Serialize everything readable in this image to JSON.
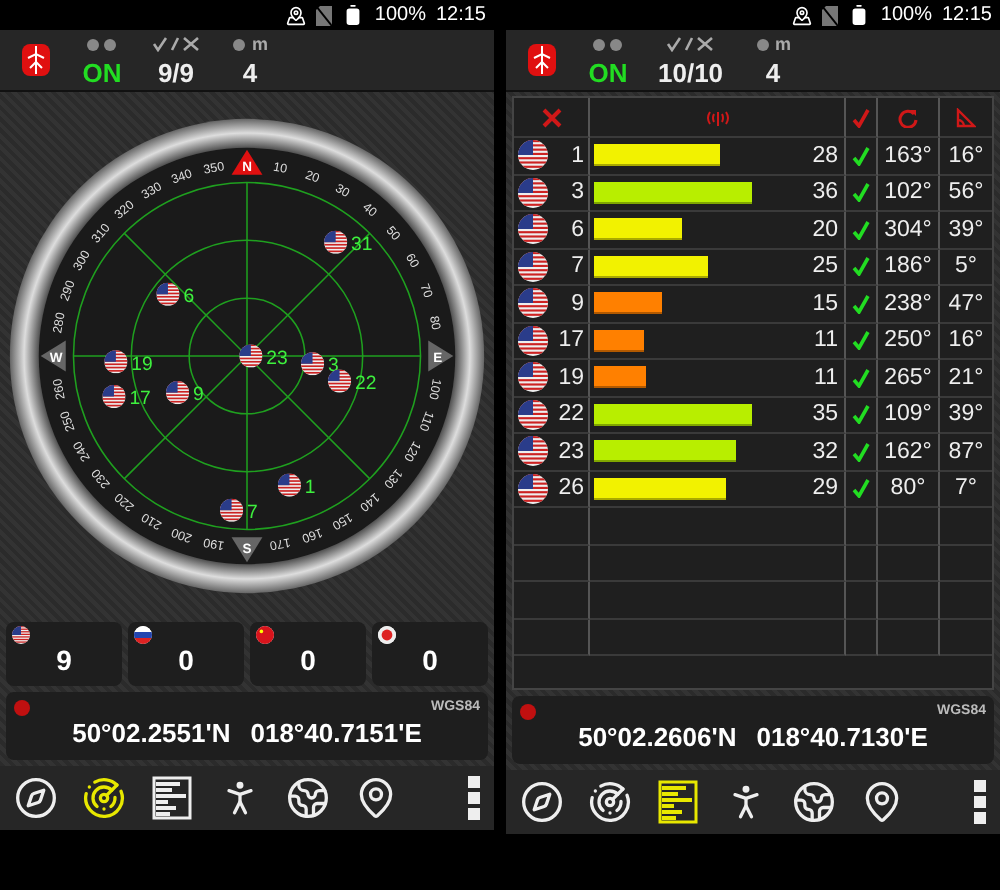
{
  "screens": [
    {
      "status_bar": {
        "battery": "100%",
        "time": "12:15"
      },
      "header": {
        "fix": "ON",
        "fix_on": true,
        "satellites": "9/9",
        "accuracy": "4",
        "accuracy_unit": "m"
      },
      "main": {
        "kind": "radar",
        "compass": {
          "north": "N",
          "east": "E",
          "south": "S",
          "west": "W",
          "degrees": [
            "10",
            "20",
            "30",
            "40",
            "50",
            "60",
            "70",
            "80",
            "100",
            "110",
            "120",
            "130",
            "140",
            "150",
            "160",
            "170",
            "190",
            "200",
            "210",
            "220",
            "230",
            "240",
            "250",
            "260",
            "280",
            "290",
            "300",
            "310",
            "320",
            "330",
            "340",
            "350"
          ]
        },
        "satellites": [
          {
            "label": "31",
            "kind": "us"
          },
          {
            "label": "6",
            "kind": "us"
          },
          {
            "label": "23",
            "kind": "us"
          },
          {
            "label": "3",
            "kind": "us"
          },
          {
            "label": "22",
            "kind": "us"
          },
          {
            "label": "19",
            "kind": "us"
          },
          {
            "label": "17",
            "kind": "us"
          },
          {
            "label": "9",
            "kind": "us"
          },
          {
            "label": "1",
            "kind": "us"
          },
          {
            "label": "7",
            "kind": "us"
          }
        ]
      },
      "constellations": [
        {
          "kind": "us",
          "count": "9"
        },
        {
          "kind": "ru",
          "count": "0"
        },
        {
          "kind": "cn",
          "count": "0"
        },
        {
          "kind": "jp",
          "count": "0"
        }
      ],
      "position": {
        "datum": "WGS84",
        "latitude": "50°02.2551'N",
        "longitude": "018°40.7151'E"
      },
      "nav": [
        {
          "kind": "compass",
          "selected": false
        },
        {
          "kind": "radar",
          "selected": true
        },
        {
          "kind": "table",
          "selected": false
        },
        {
          "kind": "walk",
          "selected": false
        },
        {
          "kind": "globe",
          "selected": false
        },
        {
          "kind": "pin",
          "selected": false
        },
        {
          "kind": "menu",
          "selected": false
        }
      ]
    },
    {
      "status_bar": {
        "battery": "100%",
        "time": "12:15"
      },
      "header": {
        "fix": "ON",
        "fix_on": true,
        "satellites": "10/10",
        "accuracy": "4",
        "accuracy_unit": "m"
      },
      "main": {
        "kind": "table",
        "rows": [
          {
            "kind": "us",
            "prn": "1",
            "level": 0.51,
            "color": "#f2f200",
            "snr": "28",
            "used": true,
            "azimuth": "163°",
            "elevation": "16°"
          },
          {
            "kind": "us",
            "prn": "3",
            "level": 0.64,
            "color": "#b8ee00",
            "snr": "36",
            "used": true,
            "azimuth": "102°",
            "elevation": "56°"
          },
          {
            "kind": "us",
            "prn": "6",
            "level": 0.36,
            "color": "#f2f200",
            "snr": "20",
            "used": true,
            "azimuth": "304°",
            "elevation": "39°"
          },
          {
            "kind": "us",
            "prn": "7",
            "level": 0.46,
            "color": "#f2f200",
            "snr": "25",
            "used": true,
            "azimuth": "186°",
            "elevation": "5°"
          },
          {
            "kind": "us",
            "prn": "9",
            "level": 0.28,
            "color": "#ff8000",
            "snr": "15",
            "used": true,
            "azimuth": "238°",
            "elevation": "47°"
          },
          {
            "kind": "us",
            "prn": "17",
            "level": 0.2,
            "color": "#ff8000",
            "snr": "11",
            "used": true,
            "azimuth": "250°",
            "elevation": "16°"
          },
          {
            "kind": "us",
            "prn": "19",
            "level": 0.21,
            "color": "#ff8000",
            "snr": "11",
            "used": true,
            "azimuth": "265°",
            "elevation": "21°"
          },
          {
            "kind": "us",
            "prn": "22",
            "level": 0.64,
            "color": "#b8ee00",
            "snr": "35",
            "used": true,
            "azimuth": "109°",
            "elevation": "39°"
          },
          {
            "kind": "us",
            "prn": "23",
            "level": 0.58,
            "color": "#b8ee00",
            "snr": "32",
            "used": true,
            "azimuth": "162°",
            "elevation": "87°"
          },
          {
            "kind": "us",
            "prn": "26",
            "level": 0.54,
            "color": "#f2f200",
            "snr": "29",
            "used": true,
            "azimuth": "80°",
            "elevation": "7°"
          }
        ]
      },
      "position": {
        "datum": "WGS84",
        "latitude": "50°02.2606'N",
        "longitude": "018°40.7130'E"
      },
      "nav": [
        {
          "kind": "compass",
          "selected": false
        },
        {
          "kind": "radar",
          "selected": false
        },
        {
          "kind": "table",
          "selected": true
        },
        {
          "kind": "walk",
          "selected": false
        },
        {
          "kind": "globe",
          "selected": false
        },
        {
          "kind": "pin",
          "selected": false
        },
        {
          "kind": "menu",
          "selected": false
        }
      ]
    }
  ]
}
